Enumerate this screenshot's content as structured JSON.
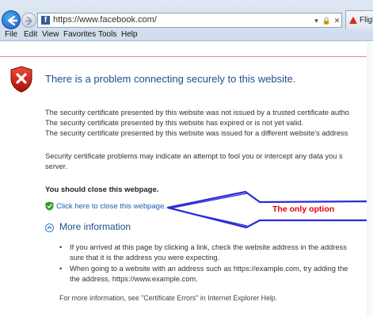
{
  "browser": {
    "address": "https://www.facebook.com/",
    "favicon_letter": "f",
    "address_buttons": [
      "▾",
      "🔒",
      "✕"
    ],
    "tab_label": "Fligh",
    "menu": [
      "File",
      "Edit",
      "View",
      "Favorites",
      "Tools",
      "Help"
    ]
  },
  "page": {
    "title": "There is a problem connecting securely to this website.",
    "cert_lines": [
      "The security certificate presented by this website was not issued by a trusted certificate autho",
      "The security certificate presented by this website has expired or is not yet valid.",
      "The security certificate presented by this website was issued for a different website's address"
    ],
    "warning_lines": [
      "Security certificate problems may indicate an attempt to fool you or intercept any data you s",
      "server."
    ],
    "close_heading": "You should close this webpage.",
    "close_link": "Click here to close this webpage.",
    "more_info": "More information",
    "bullets": [
      [
        "If you arrived at this page by clicking a link, check the website address in the address",
        "sure that it is the address you were expecting."
      ],
      [
        "When going to a website with an address such as https://example.com, try adding the",
        "the address, https://www.example.com."
      ]
    ],
    "footer": "For more information, see \"Certificate Errors\" in Internet Explorer Help."
  },
  "annotation": {
    "text": "The only option",
    "arrow_color": "#2b2bd6",
    "text_color": "#e00000"
  }
}
